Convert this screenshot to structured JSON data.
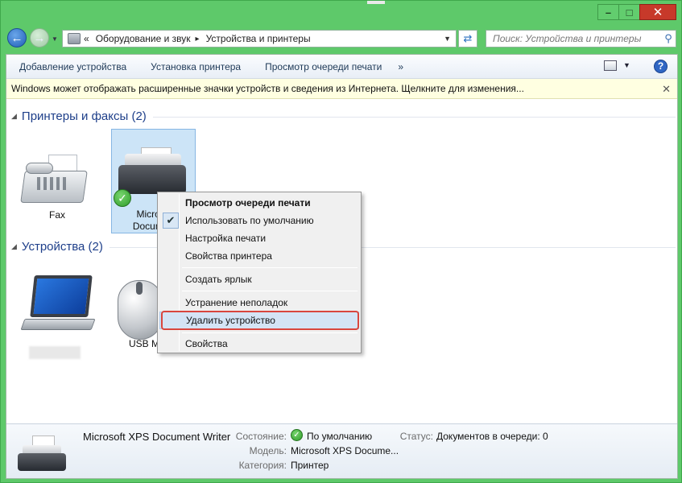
{
  "window": {
    "minimize": "–",
    "maximize": "□",
    "close": "✕"
  },
  "nav": {
    "back_icon": "arrow-left-icon",
    "forward_icon": "arrow-right-icon",
    "breadcrumb_prefix": "«",
    "breadcrumb": [
      "Оборудование и звук",
      "Устройства и принтеры"
    ],
    "breadcrumb_separator": "▸",
    "search_placeholder": "Поиск: Устройства и принтеры"
  },
  "toolbar": {
    "items": [
      "Добавление устройства",
      "Установка принтера",
      "Просмотр очереди печати"
    ],
    "more": "»"
  },
  "infobar": {
    "text": "Windows может отображать расширенные значки устройств и сведения из Интернета.  Щелкните для изменения...",
    "close": "✕"
  },
  "groups": [
    {
      "title": "Принтеры и факсы (2)",
      "devices": [
        {
          "label": "Fax"
        },
        {
          "label_line1": "Microso",
          "label_line2": "Documen"
        }
      ]
    },
    {
      "title": "Устройства (2)",
      "devices": [
        {
          "label": ""
        },
        {
          "label": "USB M"
        }
      ]
    }
  ],
  "context_menu": {
    "items": [
      {
        "label": "Просмотр очереди печати",
        "bold": true
      },
      {
        "label": "Использовать по умолчанию",
        "checked": true
      },
      {
        "label": "Настройка печати"
      },
      {
        "label": "Свойства принтера"
      },
      {
        "label": "Создать ярлык"
      },
      {
        "label": "Устранение неполадок"
      },
      {
        "label": "Удалить устройство",
        "highlighted": true
      },
      {
        "label": "Свойства"
      }
    ],
    "check_mark": "✔"
  },
  "details": {
    "name": "Microsoft XPS Document Writer",
    "state_label": "Состояние:",
    "state_value": "По умолчанию",
    "status_label": "Статус:",
    "status_value": "Документов в очереди: 0",
    "model_label": "Модель:",
    "model_value": "Microsoft XPS Docume...",
    "category_label": "Категория:",
    "category_value": "Принтер"
  },
  "colors": {
    "window_frame": "#5ec96a",
    "highlight_box": "#d9463e",
    "group_header": "#1e3f8a"
  }
}
